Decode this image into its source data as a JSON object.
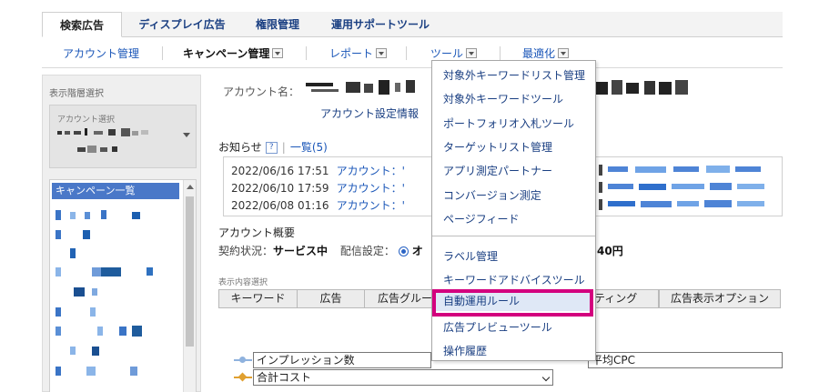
{
  "tabs": [
    {
      "label": "検索広告"
    },
    {
      "label": "ディスプレイ広告"
    },
    {
      "label": "権限管理"
    },
    {
      "label": "運用サポートツール"
    }
  ],
  "subnav": {
    "account_mgmt": "アカウント管理",
    "campaign_mgmt": "キャンペーン管理",
    "report": "レポート",
    "tools": "ツール",
    "optimize": "最適化"
  },
  "left": {
    "title": "表示階層選択",
    "account_select": "アカウント選択",
    "campaign_list": "キャンペーン一覧"
  },
  "main": {
    "account_name_label": "アカウント名：",
    "account_settings": "アカウント設定情報",
    "notice_label": "お知らせ",
    "help_icon": "?",
    "list_link": "一覧(5)",
    "news": [
      {
        "date": "2022/06/16 17:51",
        "text": "アカウント：'"
      },
      {
        "date": "2022/06/10 17:59",
        "text": "アカウント：'"
      },
      {
        "date": "2022/06/08 01:16",
        "text": "アカウント：'"
      }
    ],
    "overview_title": "アカウント概要",
    "contract_label": "契約状況：",
    "contract_value": "サービス中",
    "delivery_label": "配信設定：",
    "delivery_value": "オ",
    "amount_suffix": "40円",
    "view_label": "表示内容選択",
    "view_buttons": [
      "キーワード",
      "広告",
      "広告グルー",
      "ティング",
      "広告表示オプション"
    ],
    "metric1": "インプレッション数",
    "metric2": "合計コスト",
    "metric3": "平均CPC"
  },
  "menu": {
    "items_top": [
      "対象外キーワードリスト管理",
      "対象外キーワードツール",
      "ポートフォリオ入札ツール",
      "ターゲットリスト管理",
      "アプリ測定パートナー",
      "コンバージョン測定",
      "ページフィード"
    ],
    "items_bottom": [
      "ラベル管理",
      "キーワードアドバイスツール",
      "自動運用ルール",
      "広告プレビューツール",
      "操作履歴"
    ]
  },
  "colors": {
    "highlight": "#d3007e",
    "link": "#1a3f82",
    "selected_bg": "#4a78c8"
  }
}
